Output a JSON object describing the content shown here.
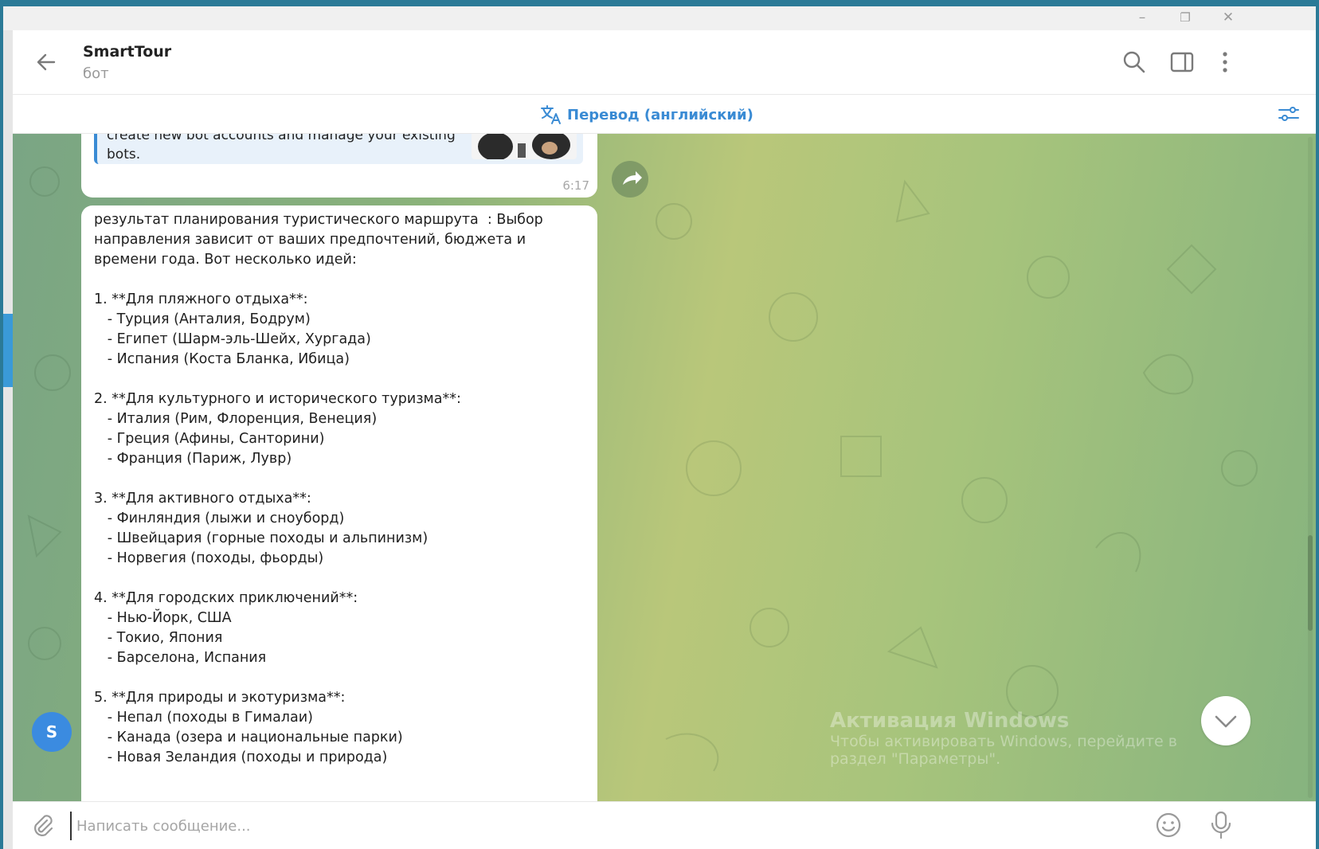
{
  "window": {
    "minimize_glyph": "–",
    "restore_glyph": "❐",
    "close_glyph": "✕"
  },
  "header": {
    "title": "SmartTour",
    "subtitle": "бот",
    "back_icon": "arrow-left-icon",
    "search_icon": "search-icon",
    "panel_icon": "side-panel-icon",
    "menu_icon": "more-vertical-icon"
  },
  "translate_bar": {
    "label": "Перевод (английский)",
    "icon": "translate-icon",
    "settings_icon": "sliders-icon"
  },
  "messages": {
    "previous": {
      "quote_text": "create new bot accounts and manage your existing bots.",
      "time": "6:17"
    },
    "main": {
      "text": "результат планирования туристического маршрута  : Выбор направления зависит от ваших предпочтений, бюджета и времени года. Вот несколько идей:\n\n1. **Для пляжного отдыха**:\n   - Турция (Анталия, Бодрум)\n   - Египет (Шарм-эль-Шейх, Хургада)\n   - Испания (Коста Бланка, Ибица)\n\n2. **Для культурного и исторического туризма**:\n   - Италия (Рим, Флоренция, Венеция)\n   - Греция (Афины, Санторини)\n   - Франция (Париж, Лувр)\n\n3. **Для активного отдыха**:\n   - Финляндия (лыжи и сноуборд)\n   - Швейцария (горные походы и альпинизм)\n   - Норвегия (походы, фьорды)\n\n4. **Для городских приключений**:\n   - Нью-Йорк, США\n   - Токио, Япония\n   - Барселона, Испания\n\n5. **Для природы и экотуризма**:\n   - Непал (походы в Гималаи)\n   - Канада (озера и национальные парки)\n   - Новая Зеландия (походы и природа)"
    },
    "avatar_letter": "S"
  },
  "watermark": {
    "title": "Активация Windows",
    "line1": "Чтобы активировать Windows, перейдите в",
    "line2": "раздел \"Параметры\"."
  },
  "input": {
    "placeholder": "Написать сообщение...",
    "attach_icon": "paperclip-icon",
    "emoji_icon": "smile-icon",
    "mic_icon": "microphone-icon"
  },
  "colors": {
    "accent": "#3a8bd4",
    "avatar": "#3b8be0",
    "frame": "#2b7a97"
  }
}
